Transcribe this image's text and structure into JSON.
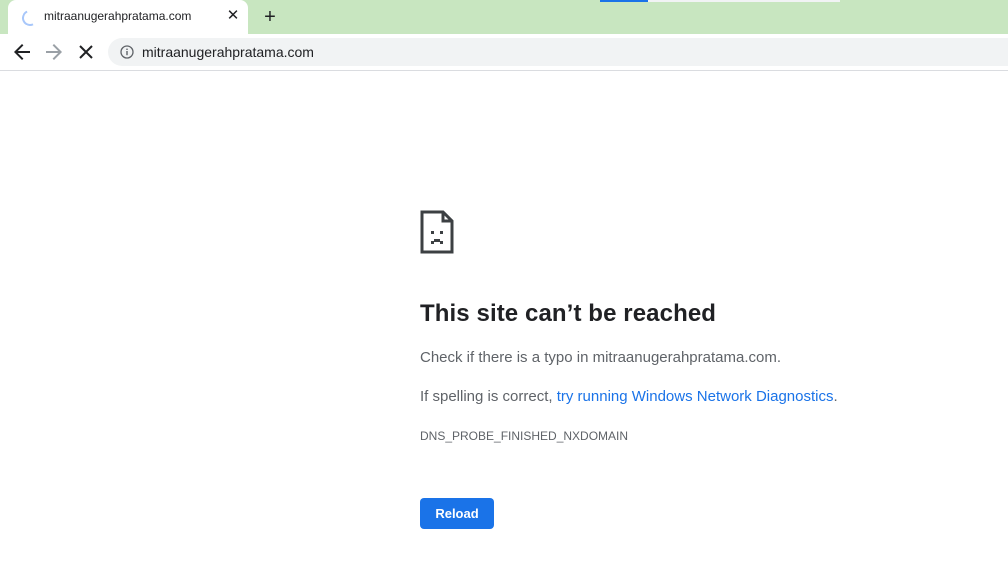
{
  "tab": {
    "title": "mitraanugerahpratama.com",
    "close_glyph": "✕",
    "status_icon": "loading-spinner-icon"
  },
  "new_tab_glyph": "+",
  "toolbar": {
    "back_icon": "back-arrow-icon",
    "forward_icon": "forward-arrow-icon",
    "stop_icon": "stop-loading-icon",
    "site_info_icon": "info-icon"
  },
  "omnibox": {
    "url": "mitraanugerahpratama.com"
  },
  "error_page": {
    "icon": "sad-document-icon",
    "title": "This site can’t be reached",
    "line1": "Check if there is a typo in mitraanugerahpratama.com.",
    "line2_prefix": "If spelling is correct, ",
    "line2_link": "try running Windows Network Diagnostics",
    "line2_suffix": ".",
    "error_code": "DNS_PROBE_FINISHED_NXDOMAIN",
    "reload_label": "Reload"
  },
  "colors": {
    "tabstrip": "#c8e6c0",
    "link": "#1a73e8",
    "button": "#1a73e8",
    "title": "#202124",
    "body_text": "#5f6368"
  }
}
